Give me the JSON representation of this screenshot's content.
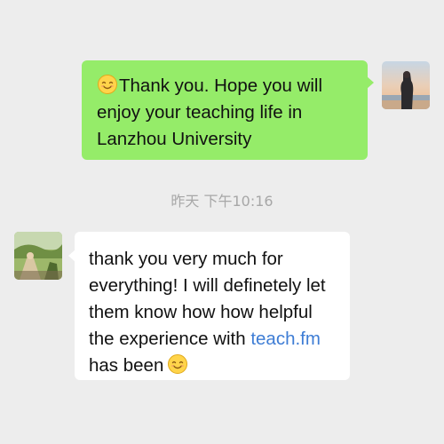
{
  "chat": {
    "sent_message": {
      "emoji": "smiling-face-icon",
      "lines": [
        "Thank you. Hope you will",
        "enjoy your teaching life in",
        "Lanzhou University"
      ]
    },
    "timestamp": "昨天 下午10:16",
    "received_message": {
      "lines": [
        "thank you very much for",
        "everything! I will definetely let",
        "them know how how helpful"
      ],
      "line4_prefix": "the experience with ",
      "link_text": "teach.fm",
      "line5_text": "has been",
      "emoji": "smiling-face-icon"
    }
  },
  "colors": {
    "background": "#ededed",
    "sent_bubble": "#95ec69",
    "received_bubble": "#ffffff",
    "link": "#3e7dd5",
    "timestamp_text": "#a7a7a7"
  }
}
